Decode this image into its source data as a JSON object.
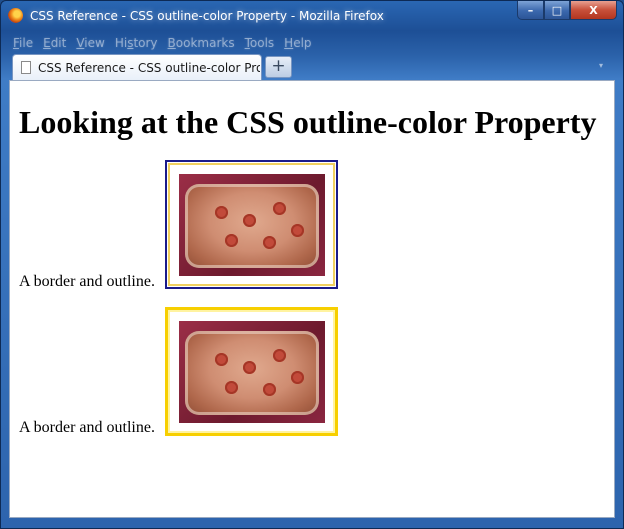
{
  "window": {
    "title": "CSS Reference - CSS outline-color Property - Mozilla Firefox",
    "controls": {
      "minimize": "–",
      "maximize": "□",
      "close": "X"
    }
  },
  "menu": [
    {
      "prefix": "F",
      "rest": "ile"
    },
    {
      "prefix": "E",
      "rest": "dit"
    },
    {
      "prefix": "V",
      "rest": "iew"
    },
    {
      "prefix": "",
      "rest": "Hi",
      "u": "s",
      "tail": "tory"
    },
    {
      "prefix": "B",
      "rest": "ookmarks"
    },
    {
      "prefix": "T",
      "rest": "ools"
    },
    {
      "prefix": "H",
      "rest": "elp"
    }
  ],
  "tabs": {
    "active_label": "CSS Reference - CSS outline-color Prope...",
    "new_tab_label": "+",
    "list_arrow": "▾"
  },
  "page": {
    "heading": "Looking at the CSS outline-color Property",
    "examples": [
      {
        "label": "A border and outline.",
        "border_color": "#1a1a8a",
        "outline_color": "#f0d060"
      },
      {
        "label": "A border and outline.",
        "border_color": "#f7cf00",
        "outline_color": "#fff3a0"
      }
    ]
  },
  "colors": {
    "titlebar": "#1d4f96",
    "close_button": "#c8503a",
    "page_background": "#ffffff"
  }
}
